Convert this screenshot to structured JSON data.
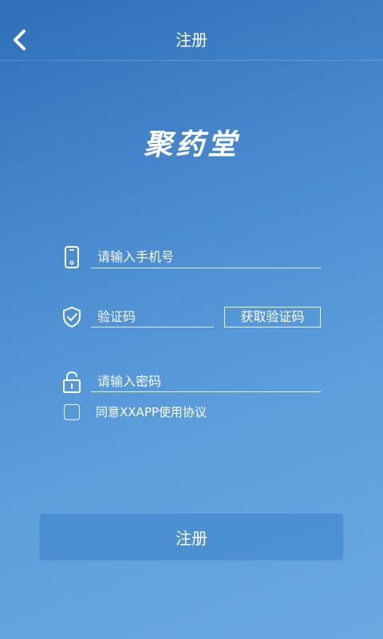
{
  "header": {
    "title": "注册",
    "back_icon": "chevron-left-icon"
  },
  "logo": {
    "text": "聚药堂"
  },
  "form": {
    "phone": {
      "placeholder": "请输入手机号",
      "icon": "phone-icon"
    },
    "code": {
      "placeholder": "验证码",
      "icon": "shield-check-icon"
    },
    "get_code_label": "获取验证码",
    "password": {
      "placeholder": "请输入密码",
      "icon": "lock-icon"
    },
    "agree_label": "同意XXAPP使用协议",
    "agree_checked": false
  },
  "submit_label": "注册",
  "colors": {
    "background_top": "#2f6fb8",
    "background_bottom": "#6aa8e0",
    "text": "#ffffff"
  }
}
